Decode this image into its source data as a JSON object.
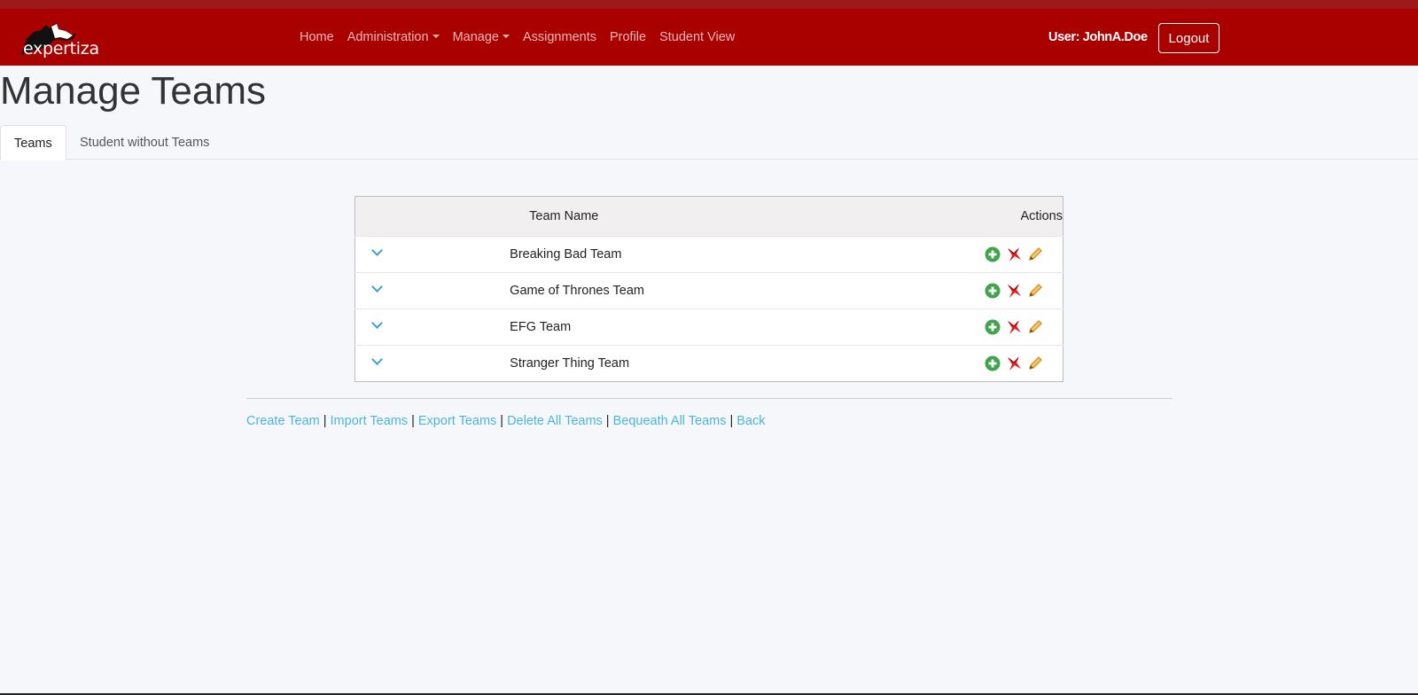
{
  "app": {
    "logo_text": "expertiza",
    "logo_icon": "wolf-icon"
  },
  "nav": {
    "items": [
      {
        "label": "Home",
        "dropdown": false
      },
      {
        "label": "Administration",
        "dropdown": true
      },
      {
        "label": "Manage",
        "dropdown": true
      },
      {
        "label": "Assignments",
        "dropdown": false
      },
      {
        "label": "Profile",
        "dropdown": false
      },
      {
        "label": "Student View",
        "dropdown": false
      }
    ],
    "user_label": "User: JohnA.Doe",
    "logout_label": "Logout"
  },
  "page": {
    "title": "Manage Teams",
    "tabs": [
      {
        "label": "Teams",
        "active": true
      },
      {
        "label": "Student without Teams",
        "active": false
      }
    ]
  },
  "table": {
    "headers": {
      "name": "Team Name",
      "actions": "Actions"
    },
    "rows": [
      {
        "name": "Breaking Bad Team"
      },
      {
        "name": "Game of Thrones Team"
      },
      {
        "name": "EFG Team"
      },
      {
        "name": "Stranger Thing Team"
      }
    ],
    "action_icons": [
      "add-member-icon",
      "delete-icon",
      "edit-icon"
    ]
  },
  "footer": {
    "links": [
      "Create Team",
      "Import Teams",
      "Export Teams",
      "Delete All Teams",
      "Bequeath All Teams",
      "Back"
    ],
    "separator": "|"
  },
  "colors": {
    "navbar": "#a90000",
    "link": "#49b6dd",
    "add_icon": "#3fa44c",
    "delete_icon": "#e02020",
    "edit_icon": "#d08a1a"
  }
}
